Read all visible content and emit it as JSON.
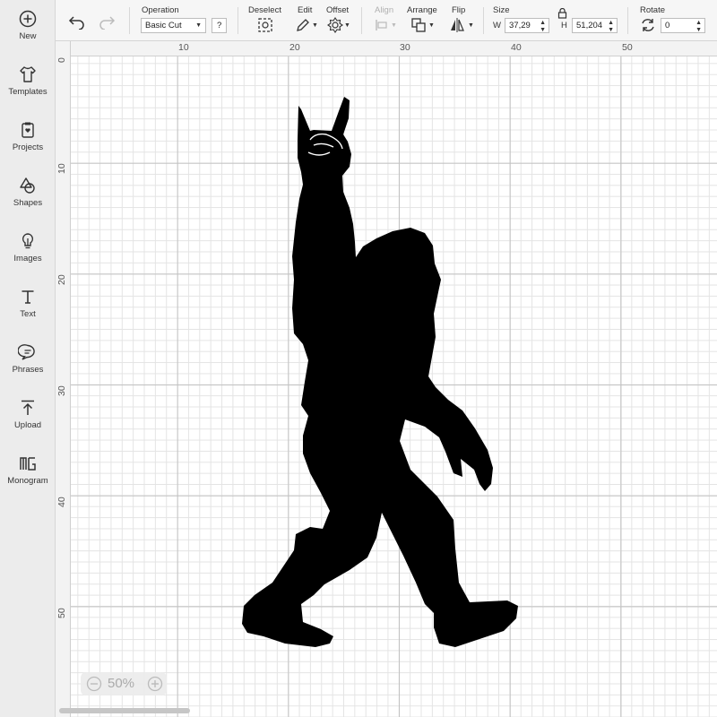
{
  "sidebar": {
    "items": [
      {
        "label": "New",
        "icon": "plus-circle-icon"
      },
      {
        "label": "Templates",
        "icon": "tshirt-icon"
      },
      {
        "label": "Projects",
        "icon": "clipboard-icon"
      },
      {
        "label": "Shapes",
        "icon": "shapes-icon"
      },
      {
        "label": "Images",
        "icon": "lightbulb-icon"
      },
      {
        "label": "Text",
        "icon": "text-icon"
      },
      {
        "label": "Phrases",
        "icon": "speech-bubble-icon"
      },
      {
        "label": "Upload",
        "icon": "upload-icon"
      },
      {
        "label": "Monogram",
        "icon": "monogram-icon"
      }
    ]
  },
  "toolbar": {
    "operation": {
      "label": "Operation",
      "value": "Basic Cut",
      "help": "?"
    },
    "deselect_label": "Deselect",
    "edit_label": "Edit",
    "offset_label": "Offset",
    "align_label": "Align",
    "arrange_label": "Arrange",
    "flip_label": "Flip",
    "size": {
      "label": "Size",
      "w_label": "W",
      "w_value": "37,29",
      "h_label": "H",
      "h_value": "51,204"
    },
    "rotate": {
      "label": "Rotate",
      "value": "0"
    }
  },
  "ruler": {
    "top_labels": [
      "10",
      "20",
      "30",
      "40",
      "50"
    ],
    "left_labels": [
      "0",
      "10",
      "20",
      "30",
      "40",
      "50"
    ]
  },
  "zoom": {
    "value": "50%"
  },
  "colors": {
    "silhouette": "#000000",
    "grid_major": "#c2c2c2",
    "grid_minor": "#e4e4e4",
    "sidebar_bg": "#ececec"
  }
}
